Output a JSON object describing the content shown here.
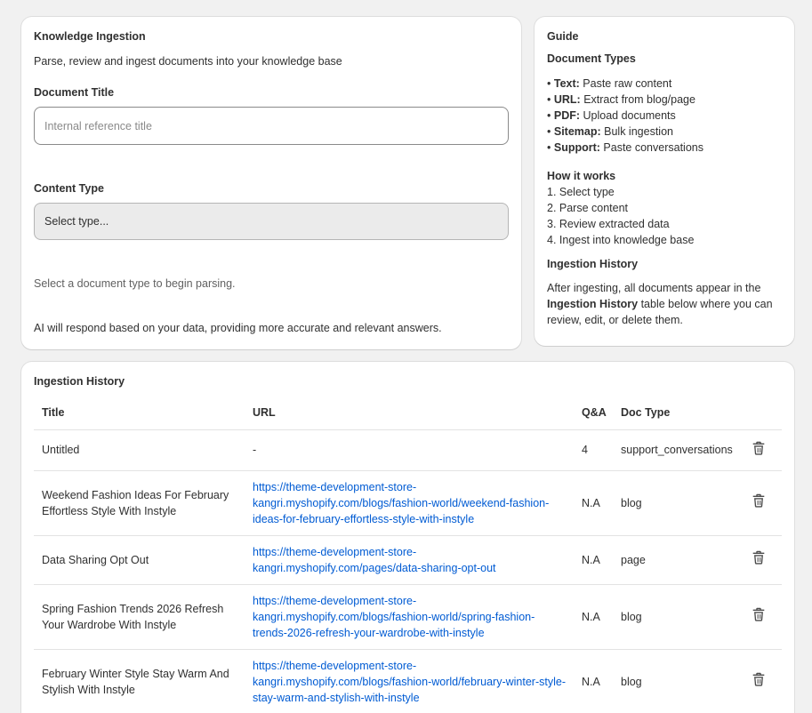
{
  "ingestion": {
    "title": "Knowledge Ingestion",
    "subtitle": "Parse, review and ingest documents into your knowledge base",
    "doc_title_label": "Document Title",
    "doc_title_placeholder": "Internal reference title",
    "content_type_label": "Content Type",
    "content_type_value": "Select type...",
    "hint": "Select a document type to begin parsing.",
    "note": "AI will respond based on your data, providing more accurate and relevant answers."
  },
  "guide": {
    "title": "Guide",
    "doc_types_title": "Document Types",
    "types": [
      {
        "name": "Text:",
        "desc": "Paste raw content"
      },
      {
        "name": "URL:",
        "desc": "Extract from blog/page"
      },
      {
        "name": "PDF:",
        "desc": "Upload documents"
      },
      {
        "name": "Sitemap:",
        "desc": "Bulk ingestion"
      },
      {
        "name": "Support:",
        "desc": "Paste conversations"
      }
    ],
    "how_title": "How it works",
    "steps": [
      "1. Select type",
      "2. Parse content",
      "3. Review extracted data",
      "4. Ingest into knowledge base"
    ],
    "history_title": "Ingestion History",
    "history_pre": "After ingesting, all documents appear in the",
    "history_bold": "Ingestion History",
    "history_post": "table below where you can review, edit, or delete them."
  },
  "history": {
    "title": "Ingestion History",
    "columns": [
      "Title",
      "URL",
      "Q&A",
      "Doc Type"
    ],
    "rows": [
      {
        "title": "Untitled",
        "url": "-",
        "qa": "4",
        "doc_type": "support_conversations"
      },
      {
        "title": "Weekend Fashion Ideas For February Effortless Style With Instyle",
        "url": "https://theme-development-store-kangri.myshopify.com/blogs/fashion-world/weekend-fashion-ideas-for-february-effortless-style-with-instyle",
        "qa": "N.A",
        "doc_type": "blog"
      },
      {
        "title": "Data Sharing Opt Out",
        "url": "https://theme-development-store-kangri.myshopify.com/pages/data-sharing-opt-out",
        "qa": "N.A",
        "doc_type": "page"
      },
      {
        "title": "Spring Fashion Trends 2026 Refresh Your Wardrobe With Instyle",
        "url": "https://theme-development-store-kangri.myshopify.com/blogs/fashion-world/spring-fashion-trends-2026-refresh-your-wardrobe-with-instyle",
        "qa": "N.A",
        "doc_type": "blog"
      },
      {
        "title": "February Winter Style Stay Warm And Stylish With Instyle",
        "url": "https://theme-development-store-kangri.myshopify.com/blogs/fashion-world/february-winter-style-stay-warm-and-stylish-with-instyle",
        "qa": "N.A",
        "doc_type": "blog"
      }
    ]
  }
}
